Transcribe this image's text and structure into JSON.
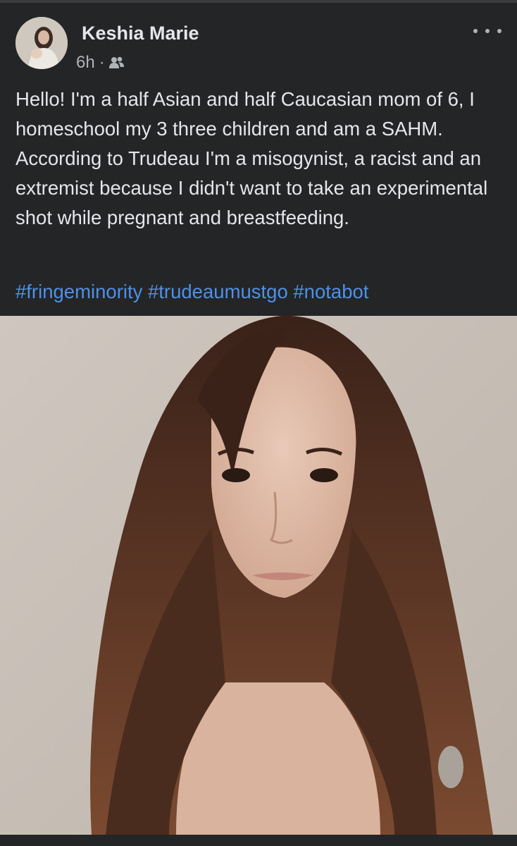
{
  "post": {
    "author_name": "Keshia Marie",
    "time": "6h",
    "separator": "·",
    "audience_icon": "friends-icon",
    "more_icon": "more-options-icon",
    "text": "Hello! I'm a half Asian and half Caucasian mom of 6, I homeschool my 3 three children and am a SAHM. According to Trudeau I'm a misogynist, a racist and an extremist because I didn't want to take an experimental shot while pregnant and breastfeeding.",
    "hashtags": [
      "#fringeminority",
      "#trudeaumustgo",
      "#notabot"
    ],
    "photo_alt": "selfie-photo"
  },
  "colors": {
    "background": "#242526",
    "text": "#e4e6eb",
    "secondary_text": "#b0b3b8",
    "link": "#4e90e8"
  }
}
